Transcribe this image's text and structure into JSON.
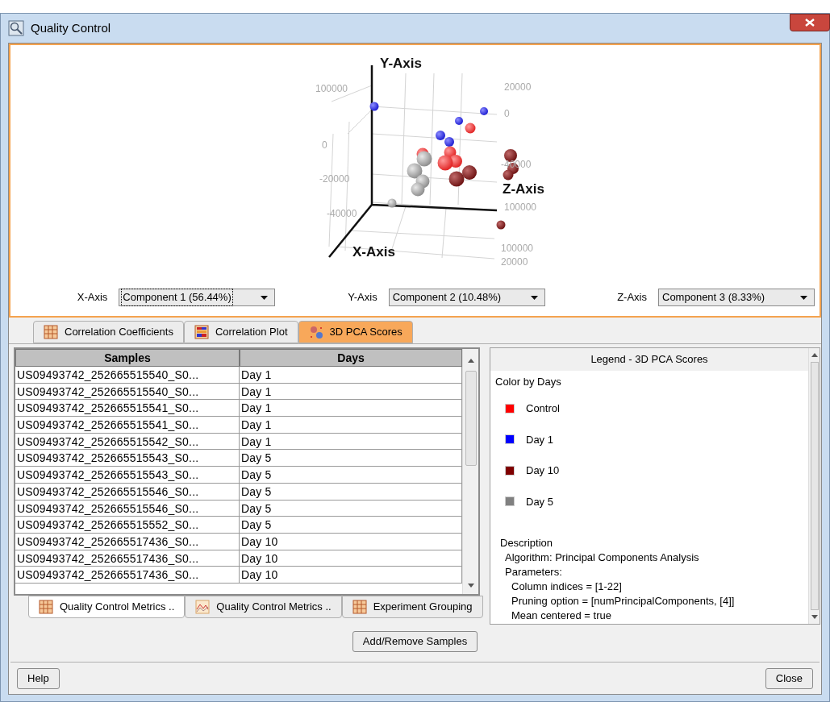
{
  "window": {
    "title": "Quality Control"
  },
  "plot": {
    "y_axis_label": "Y-Axis",
    "z_axis_label": "Z-Axis",
    "x_axis_label": "X-Axis",
    "tick_labels": [
      "100000",
      "0",
      "-20000",
      "-40000",
      "20000",
      "0",
      "-40000",
      "100000",
      "100000",
      "20000"
    ]
  },
  "axis_selectors": [
    {
      "label": "X-Axis",
      "value": "Component 1 (56.44%)",
      "focused": true
    },
    {
      "label": "Y-Axis",
      "value": "Component 2 (10.48%)",
      "focused": false
    },
    {
      "label": "Z-Axis",
      "value": "Component 3 (8.33%)",
      "focused": false
    }
  ],
  "top_tabs": [
    {
      "label": "Correlation Coefficients",
      "kind": "table",
      "selected": false
    },
    {
      "label": "Correlation Plot",
      "kind": "heatmap",
      "selected": false
    },
    {
      "label": "3D PCA Scores",
      "kind": "scatter",
      "selected": true
    }
  ],
  "table": {
    "columns": [
      "Samples",
      "Days"
    ],
    "rows": [
      [
        "US09493742_252665515540_S0...",
        "Day 1"
      ],
      [
        "US09493742_252665515540_S0...",
        "Day 1"
      ],
      [
        "US09493742_252665515541_S0...",
        "Day 1"
      ],
      [
        "US09493742_252665515541_S0...",
        "Day 1"
      ],
      [
        "US09493742_252665515542_S0...",
        "Day 1"
      ],
      [
        "US09493742_252665515543_S0...",
        "Day 5"
      ],
      [
        "US09493742_252665515543_S0...",
        "Day 5"
      ],
      [
        "US09493742_252665515546_S0...",
        "Day 5"
      ],
      [
        "US09493742_252665515546_S0...",
        "Day 5"
      ],
      [
        "US09493742_252665515552_S0...",
        "Day 5"
      ],
      [
        "US09493742_252665517436_S0...",
        "Day 10"
      ],
      [
        "US09493742_252665517436_S0...",
        "Day 10"
      ],
      [
        "US09493742_252665517436_S0...",
        "Day 10"
      ]
    ]
  },
  "bottom_tabs": [
    {
      "label": "Quality Control Metrics ..",
      "kind": "table",
      "selected": true
    },
    {
      "label": "Quality Control Metrics ..",
      "kind": "line",
      "selected": false
    },
    {
      "label": "Experiment Grouping",
      "kind": "table",
      "selected": false
    }
  ],
  "legend": {
    "title": "Legend - 3D PCA Scores",
    "subtitle": "Color by Days",
    "items": [
      {
        "label": "Control",
        "color": "#ff0000"
      },
      {
        "label": "Day 1",
        "color": "#0000ff"
      },
      {
        "label": "Day 10",
        "color": "#7f0000"
      },
      {
        "label": "Day 5",
        "color": "#808080"
      }
    ],
    "description_title": "Description",
    "description_lines": [
      {
        "text": "Algorithm: Principal Components Analysis"
      },
      {
        "text": "Parameters:",
        "children": [
          {
            "text": "Column indices = [1-22]"
          },
          {
            "text": "Pruning option = [numPrincipalComponents, [4]]"
          },
          {
            "text": "Mean centered = true"
          }
        ]
      }
    ]
  },
  "add_remove_button": "Add/Remove Samples",
  "footer_buttons": [
    "Help",
    "Close"
  ]
}
